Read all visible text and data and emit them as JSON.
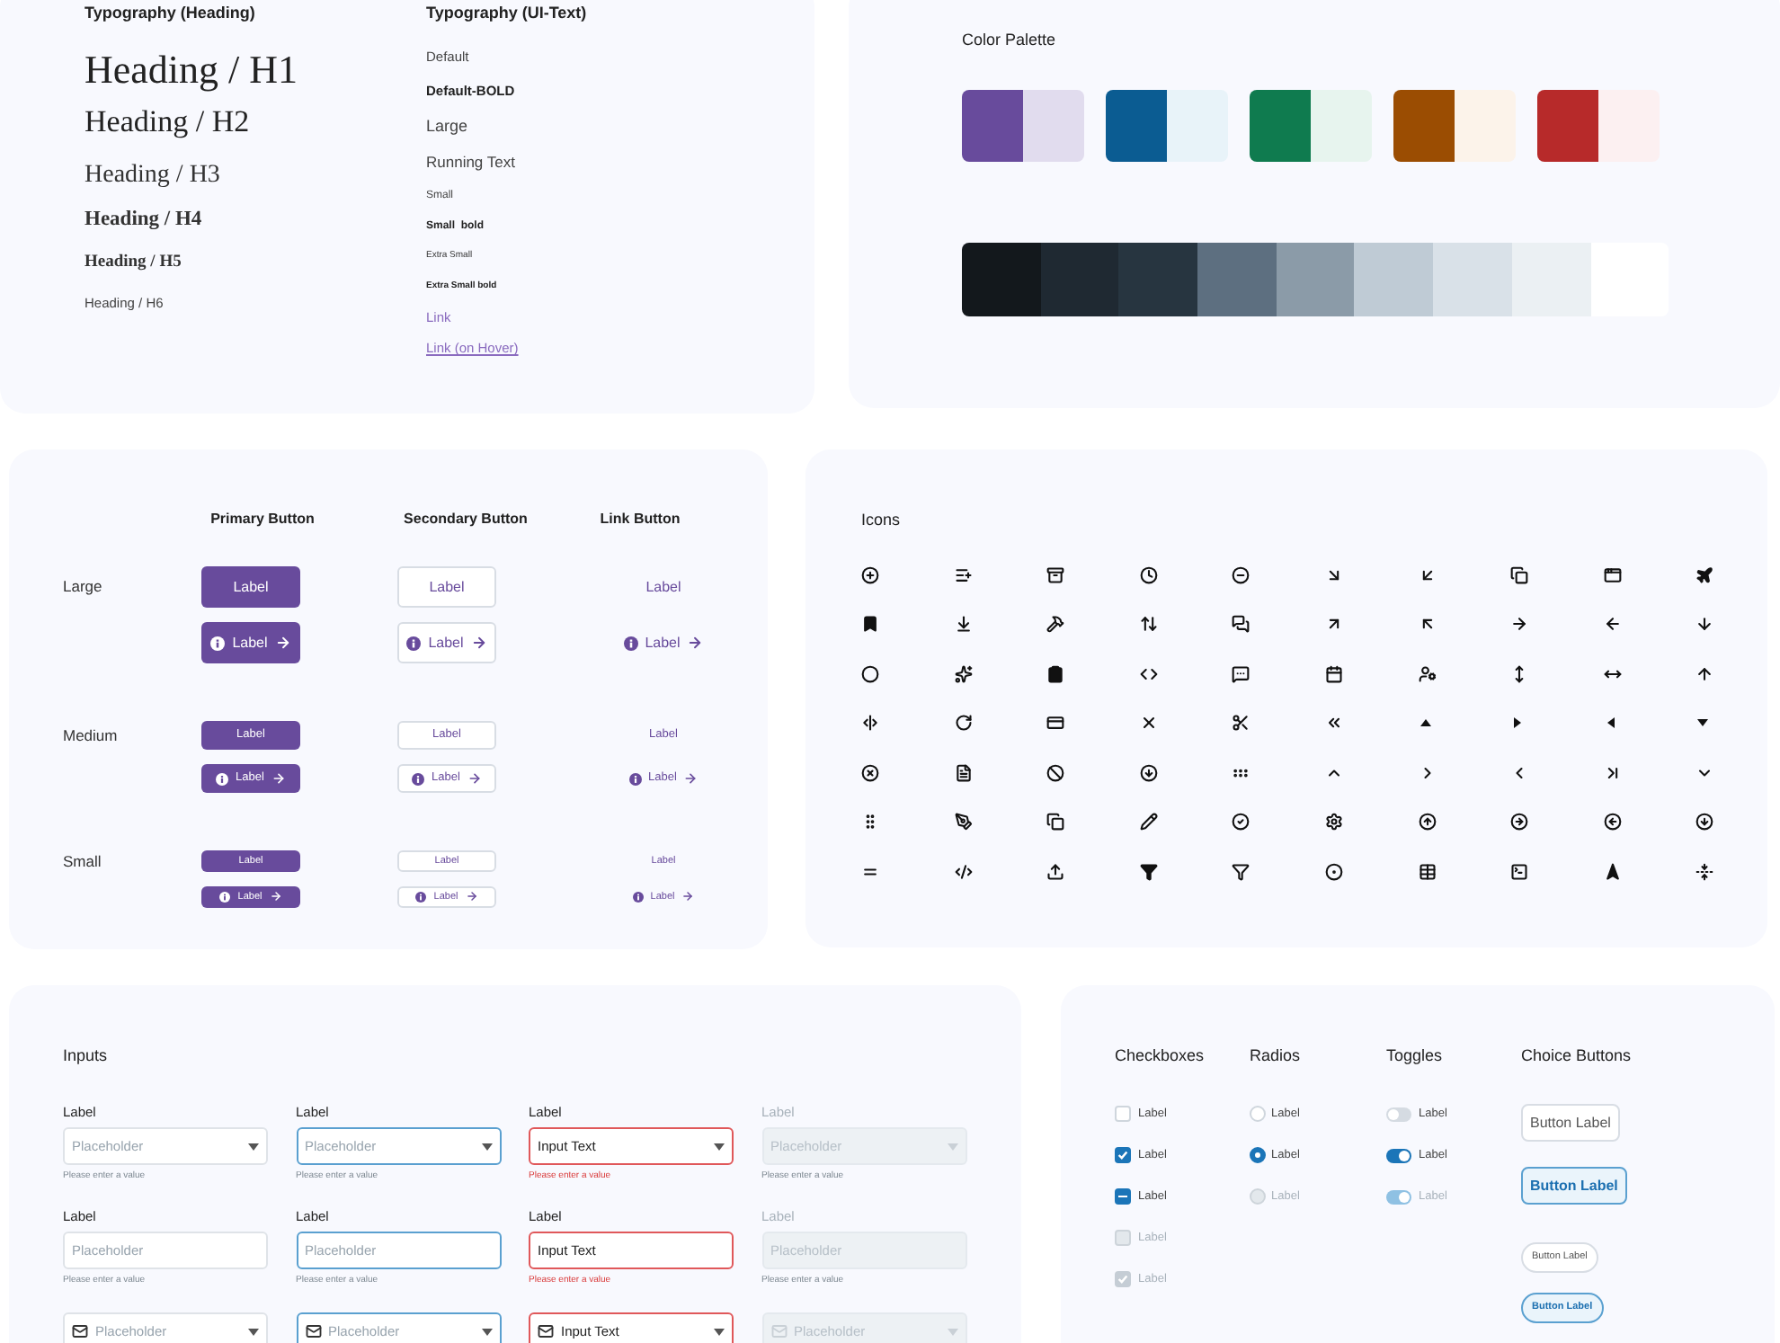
{
  "typography_heading": {
    "title": "Typography (Heading)",
    "items": [
      {
        "kind": "h1",
        "text": "Heading / H1"
      },
      {
        "kind": "h2",
        "text": "Heading / H2"
      },
      {
        "kind": "h3",
        "text": "Heading / H3"
      },
      {
        "kind": "h4",
        "text": "Heading / H4"
      },
      {
        "kind": "h5",
        "text": "Heading / H5"
      },
      {
        "kind": "h6",
        "text": "Heading / H6"
      }
    ]
  },
  "typography_ui": {
    "title": "Typography (UI-Text)",
    "items": [
      {
        "kind": "default",
        "text": "Default"
      },
      {
        "kind": "default_bold",
        "text": "Default-BOLD"
      },
      {
        "kind": "large",
        "text": "Large"
      },
      {
        "kind": "running",
        "text": "Running Text"
      },
      {
        "kind": "small",
        "text": "Small"
      },
      {
        "kind": "small_bold",
        "text": "Small  bold"
      },
      {
        "kind": "xs",
        "text": "Extra Small"
      },
      {
        "kind": "xs_bold",
        "text": "Extra Small bold"
      },
      {
        "kind": "link",
        "text": "Link"
      },
      {
        "kind": "link_hover",
        "text": "Link (on Hover)"
      }
    ]
  },
  "color_palette": {
    "title": "Color Palette",
    "swatch_groups": [
      {
        "swatches": [
          {
            "color": "#684b9c"
          },
          {
            "color": "#e1dcee"
          }
        ]
      },
      {
        "swatches": [
          {
            "color": "#0b5c92"
          },
          {
            "color": "#e8f3f9"
          }
        ]
      },
      {
        "swatches": [
          {
            "color": "#0f7b4f"
          },
          {
            "color": "#e7f4ee"
          }
        ]
      },
      {
        "swatches": [
          {
            "color": "#9b4d02"
          },
          {
            "color": "#fcf3ea"
          }
        ]
      },
      {
        "swatches": [
          {
            "color": "#b72a2a"
          },
          {
            "color": "#fcf0f1"
          }
        ]
      }
    ],
    "grays": [
      {
        "color": "#13181c"
      },
      {
        "color": "#1f2932"
      },
      {
        "color": "#273540"
      },
      {
        "color": "#5d6f80"
      },
      {
        "color": "#8b9ba8"
      },
      {
        "color": "#bfcbd5"
      },
      {
        "color": "#d9e1e8"
      },
      {
        "color": "#ebf0f3"
      },
      {
        "color": "#ffffff"
      }
    ]
  },
  "buttons": {
    "columns": [
      "Primary Button",
      "Secondary Button",
      "Link Button"
    ],
    "sizes": [
      {
        "label": "Large",
        "kind": "large",
        "rows": [
          {
            "icons": false,
            "buttons": [
              {
                "kind": "primary",
                "label": "Label"
              },
              {
                "kind": "secondary",
                "label": "Label"
              },
              {
                "kind": "link",
                "label": "Label"
              }
            ]
          },
          {
            "icons": true,
            "buttons": [
              {
                "kind": "primary",
                "label": "Label"
              },
              {
                "kind": "secondary",
                "label": "Label"
              },
              {
                "kind": "link",
                "label": "Label"
              }
            ]
          }
        ]
      },
      {
        "label": "Medium",
        "kind": "medium",
        "rows": [
          {
            "icons": false,
            "buttons": [
              {
                "kind": "primary",
                "label": "Label"
              },
              {
                "kind": "secondary",
                "label": "Label"
              },
              {
                "kind": "link",
                "label": "Label"
              }
            ]
          },
          {
            "icons": true,
            "buttons": [
              {
                "kind": "primary",
                "label": "Label"
              },
              {
                "kind": "secondary",
                "label": "Label"
              },
              {
                "kind": "link",
                "label": "Label"
              }
            ]
          }
        ]
      },
      {
        "label": "Small",
        "kind": "small",
        "rows": [
          {
            "icons": false,
            "buttons": [
              {
                "kind": "primary",
                "label": "Label"
              },
              {
                "kind": "secondary",
                "label": "Label"
              },
              {
                "kind": "link",
                "label": "Label"
              }
            ]
          },
          {
            "icons": true,
            "buttons": [
              {
                "kind": "primary",
                "label": "Label"
              },
              {
                "kind": "secondary",
                "label": "Label"
              },
              {
                "kind": "link",
                "label": "Label"
              }
            ]
          }
        ]
      }
    ]
  },
  "icons": {
    "title": "Icons"
  },
  "inputs": {
    "title": "Inputs",
    "rows": [
      {
        "kind": "select",
        "fields": [
          {
            "kind": "default",
            "label": "Label",
            "placeholder": "Placeholder",
            "hint": "Please enter a value"
          },
          {
            "kind": "focus",
            "label": "Label",
            "placeholder": "Placeholder",
            "hint": "Please enter a value"
          },
          {
            "kind": "error",
            "label": "Label",
            "value": "Input Text",
            "hint": "Please enter a value"
          },
          {
            "kind": "disabled",
            "label": "Label",
            "placeholder": "Placeholder",
            "hint": "Please enter a value"
          }
        ]
      },
      {
        "kind": "text",
        "fields": [
          {
            "kind": "default",
            "label": "Label",
            "placeholder": "Placeholder",
            "hint": "Please enter a value"
          },
          {
            "kind": "focus",
            "label": "Label",
            "placeholder": "Placeholder",
            "hint": "Please enter a value"
          },
          {
            "kind": "error",
            "label": "Label",
            "value": "Input Text",
            "hint": "Please enter a value"
          },
          {
            "kind": "disabled",
            "label": "Label",
            "placeholder": "Placeholder",
            "hint": "Please enter a value"
          }
        ]
      },
      {
        "kind": "select_icon",
        "fields": [
          {
            "kind": "default",
            "placeholder": "Placeholder"
          },
          {
            "kind": "focus",
            "placeholder": "Placeholder"
          },
          {
            "kind": "error",
            "value": "Input Text"
          },
          {
            "kind": "disabled",
            "placeholder": "Placeholder"
          }
        ]
      }
    ]
  },
  "checkboxes": {
    "title": "Checkboxes",
    "items": [
      {
        "label": "Label",
        "checked": false,
        "disabled": false
      },
      {
        "kind": "tick",
        "label": "Label",
        "checked": true,
        "disabled": false
      },
      {
        "kind": "dash",
        "label": "Label",
        "checked": true,
        "disabled": false
      },
      {
        "label": "Label",
        "checked": false,
        "disabled": true
      },
      {
        "kind": "tick",
        "label": "Label",
        "checked": true,
        "disabled": true
      }
    ]
  },
  "radios": {
    "title": "Radios",
    "items": [
      {
        "label": "Label",
        "selected": false,
        "disabled": false
      },
      {
        "label": "Label",
        "selected": true,
        "disabled": false
      },
      {
        "label": "Label",
        "selected": false,
        "disabled": true
      }
    ]
  },
  "toggles": {
    "title": "Toggles",
    "items": [
      {
        "label": "Label",
        "on": false,
        "disabled": false
      },
      {
        "label": "Label",
        "on": true,
        "disabled": false
      },
      {
        "label": "Label",
        "on": true,
        "disabled": true
      }
    ]
  },
  "choice_buttons": {
    "title": "Choice Buttons",
    "items": [
      {
        "label": "Button Label",
        "kind": "large",
        "selected": false
      },
      {
        "label": "Button Label",
        "kind": "large",
        "selected": true
      },
      {
        "label": "Button Label",
        "kind": "small",
        "selected": false
      },
      {
        "label": "Button Label",
        "kind": "small",
        "selected": true
      }
    ]
  }
}
